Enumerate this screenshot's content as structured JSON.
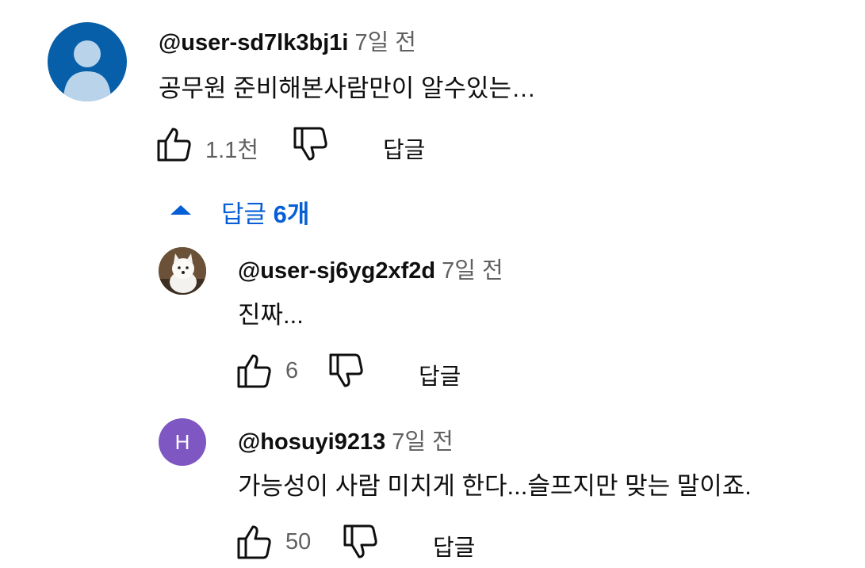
{
  "comment": {
    "author": "@user-sd7lk3bj1i",
    "time": "7일 전",
    "text": "공무원 준비해본사람만이 알수있는…",
    "likes": "1.1천",
    "reply_label": "답글",
    "replies_toggle": {
      "prefix": "답글 ",
      "count": "6개"
    }
  },
  "replies": [
    {
      "author": "@user-sj6yg2xf2d",
      "time": "7일 전",
      "text": "진짜...",
      "likes": "6",
      "reply_label": "답글"
    },
    {
      "author": "@hosuyi9213",
      "time": "7일 전",
      "text": "가능성이 사람 미치게 한다...슬프지만 맞는 말이죠.",
      "likes": "50",
      "reply_label": "답글",
      "avatar_letter": "H"
    }
  ],
  "colors": {
    "link_blue": "#065fd4",
    "avatar_blue": "#065fa8",
    "avatar_purple": "#7e57c2",
    "meta_gray": "#606060"
  },
  "icons": [
    "like-icon",
    "dislike-icon",
    "collapse-arrow-icon",
    "default-avatar-icon"
  ]
}
